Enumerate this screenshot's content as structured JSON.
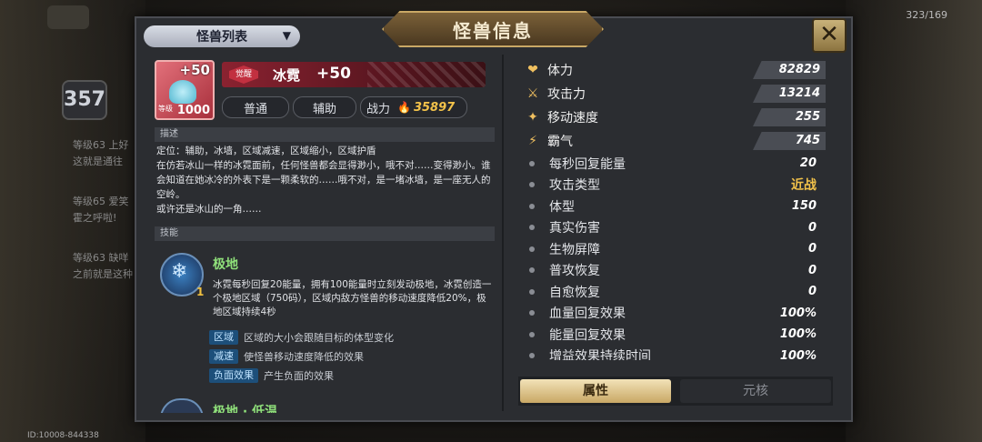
{
  "background": {
    "level_badge": "357",
    "chat_lines": [
      "等级63 上好",
      "这就是通往",
      "等级65 爱笑",
      "霍之呼啦!",
      "等级63 缺咩",
      "之前就是这种"
    ],
    "player_id": "ID:10008-844338",
    "resource": "323/169"
  },
  "header": {
    "title": "怪兽信息",
    "list_dropdown": "怪兽列表",
    "close_icon": "close-icon"
  },
  "monster": {
    "portrait_plus": "+50",
    "portrait_level_label": "等级",
    "portrait_level": "1000",
    "awaken_badge": "觉醒",
    "name": "冰霓",
    "plus": "+50",
    "rarity": "普通",
    "role": "辅助",
    "power_label": "战力",
    "power": "35897"
  },
  "description": {
    "heading": "描述",
    "lines": [
      "定位：辅助，冰墙，区域减速，区域缩小，区域护盾",
      "在仿若冰山一样的冰霓面前，任何怪兽都会显得渺小，哦不对……变得渺小。谁会知道在她冰冷的外表下是一颗柔软的……哦不对，是一堵冰墙，是一座无人的空岭。",
      "或许还是冰山的一角……"
    ]
  },
  "skills": {
    "heading": "技能",
    "skill1": {
      "icon": "snowflake-icon",
      "level": "1",
      "name": "极地",
      "desc": "冰霓每秒回复20能量，拥有100能量时立刻发动极地，冰霓创造一个极地区域（750码），区域内敌方怪兽的移动速度降低20%，极地区域持续4秒",
      "tags": [
        {
          "tag": "区域",
          "desc": "区域的大小会跟随目标的体型变化"
        },
        {
          "tag": "减速",
          "desc": "使怪兽移动速度降低的效果"
        },
        {
          "tag": "负面效果",
          "desc": "产生负面的效果"
        }
      ]
    },
    "skill2_name": "极地 · 低温"
  },
  "stats": {
    "main": [
      {
        "icon": "heart-icon",
        "glyph": "❤",
        "label": "体力",
        "value": "82829"
      },
      {
        "icon": "sword-icon",
        "glyph": "⚔",
        "label": "攻击力",
        "value": "13214"
      },
      {
        "icon": "wing-icon",
        "glyph": "✦",
        "label": "移动速度",
        "value": "255"
      },
      {
        "icon": "claw-icon",
        "glyph": "⚡",
        "label": "霸气",
        "value": "745"
      }
    ],
    "sub": [
      {
        "label": "每秒回复能量",
        "value": "20"
      },
      {
        "label": "攻击类型",
        "value": "近战"
      },
      {
        "label": "体型",
        "value": "150"
      },
      {
        "label": "真实伤害",
        "value": "0"
      },
      {
        "label": "生物屏障",
        "value": "0"
      },
      {
        "label": "普攻恢复",
        "value": "0"
      },
      {
        "label": "自愈恢复",
        "value": "0"
      },
      {
        "label": "血量回复效果",
        "value": "100%"
      },
      {
        "label": "能量回复效果",
        "value": "100%"
      },
      {
        "label": "增益效果持续时间",
        "value": "100%"
      }
    ]
  },
  "tabs": {
    "attributes": "属性",
    "core": "元核"
  }
}
